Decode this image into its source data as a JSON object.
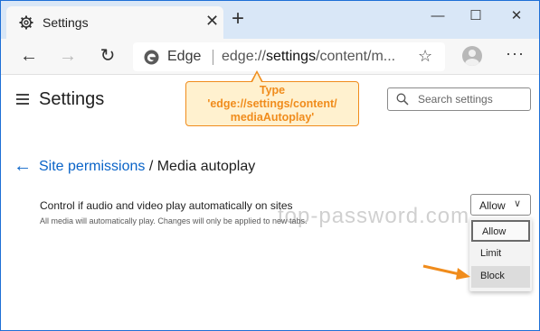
{
  "browser": {
    "tab_title": "Settings",
    "tab_icon": "gear-icon",
    "new_tab": "+",
    "window_minimize": "—",
    "window_maximize": "☐",
    "window_close": "✕",
    "tab_close": "✕",
    "back": "←",
    "forward": "→",
    "refresh": "↻",
    "brand_label": "Edge",
    "url_prefix": "edge://",
    "url_main": "settings",
    "url_rest": "/content/m...",
    "favorite": "☆",
    "more": "···",
    "accent": "#1e6fd6"
  },
  "settings": {
    "title": "Settings",
    "search_placeholder": "Search settings"
  },
  "callout": {
    "line1": "Type",
    "line2": "'edge://settings/content/",
    "line3": "mediaAutoplay'",
    "color": "#f08c1c"
  },
  "page": {
    "back": "←",
    "breadcrumb_link": "Site permissions",
    "breadcrumb_sep": " / ",
    "breadcrumb_current": "Media autoplay",
    "setting_label": "Control if audio and video play automatically on sites",
    "setting_desc": "All media will automatically play. Changes will only be applied to new tabs.",
    "select_value": "Allow",
    "select_chevron": "∨",
    "options": [
      "Allow",
      "Limit",
      "Block"
    ],
    "watermark": "top-password.com"
  }
}
